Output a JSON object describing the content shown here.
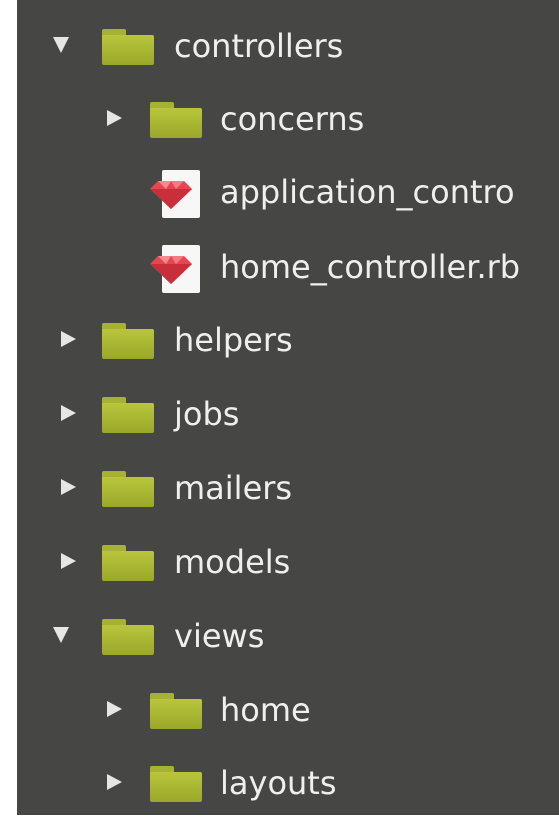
{
  "tree": {
    "controllers": {
      "label": "controllers",
      "expanded": true
    },
    "concerns": {
      "label": "concerns",
      "expanded": false
    },
    "application_controller": {
      "label": "application_contro"
    },
    "home_controller": {
      "label": "home_controller.rb"
    },
    "helpers": {
      "label": "helpers",
      "expanded": false
    },
    "jobs": {
      "label": "jobs",
      "expanded": false
    },
    "mailers": {
      "label": "mailers",
      "expanded": false
    },
    "models": {
      "label": "models",
      "expanded": false
    },
    "views": {
      "label": "views",
      "expanded": true
    },
    "home": {
      "label": "home",
      "expanded": false
    },
    "layouts": {
      "label": "layouts",
      "expanded": false
    }
  },
  "colors": {
    "panel_background": "#464745",
    "folder": "#a5b232",
    "text": "#efefee",
    "ruby_gem": "#e5464f"
  }
}
